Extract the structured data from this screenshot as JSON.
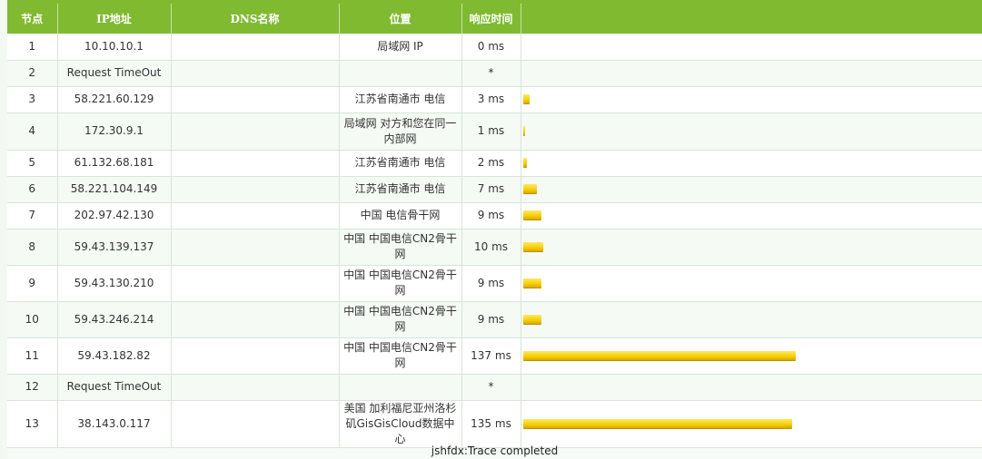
{
  "headers": {
    "hop": "节点",
    "ip": "IP地址",
    "dns": "DNS名称",
    "location": "位置",
    "time": "响应时间"
  },
  "max_ms": 137,
  "rows": [
    {
      "hop": "1",
      "ip": "10.10.10.1",
      "dns": "",
      "location": "局域网 IP",
      "time": "0 ms",
      "ms": 0
    },
    {
      "hop": "2",
      "ip": "Request TimeOut",
      "dns": "",
      "location": "",
      "time": "*",
      "ms": null
    },
    {
      "hop": "3",
      "ip": "58.221.60.129",
      "dns": "",
      "location": "江苏省南通市 电信",
      "time": "3 ms",
      "ms": 3
    },
    {
      "hop": "4",
      "ip": "172.30.9.1",
      "dns": "",
      "location": "局域网 对方和您在同一内部网",
      "time": "1 ms",
      "ms": 1
    },
    {
      "hop": "5",
      "ip": "61.132.68.181",
      "dns": "",
      "location": "江苏省南通市 电信",
      "time": "2 ms",
      "ms": 2
    },
    {
      "hop": "6",
      "ip": "58.221.104.149",
      "dns": "",
      "location": "江苏省南通市 电信",
      "time": "7 ms",
      "ms": 7
    },
    {
      "hop": "7",
      "ip": "202.97.42.130",
      "dns": "",
      "location": "中国 电信骨干网",
      "time": "9 ms",
      "ms": 9
    },
    {
      "hop": "8",
      "ip": "59.43.139.137",
      "dns": "",
      "location": "中国 中国电信CN2骨干网",
      "time": "10 ms",
      "ms": 10
    },
    {
      "hop": "9",
      "ip": "59.43.130.210",
      "dns": "",
      "location": "中国 中国电信CN2骨干网",
      "time": "9 ms",
      "ms": 9
    },
    {
      "hop": "10",
      "ip": "59.43.246.214",
      "dns": "",
      "location": "中国 中国电信CN2骨干网",
      "time": "9 ms",
      "ms": 9
    },
    {
      "hop": "11",
      "ip": "59.43.182.82",
      "dns": "",
      "location": "中国 中国电信CN2骨干网",
      "time": "137 ms",
      "ms": 137
    },
    {
      "hop": "12",
      "ip": "Request TimeOut",
      "dns": "",
      "location": "",
      "time": "*",
      "ms": null
    },
    {
      "hop": "13",
      "ip": "38.143.0.117",
      "dns": "",
      "location": "美国 加利福尼亚州洛杉矶GisGisCloud数据中心",
      "time": "135 ms",
      "ms": 135
    }
  ],
  "footer": "jshfdx:Trace completed",
  "colors": {
    "header_bg": "#7fba31",
    "bar": "#f5cf00"
  }
}
